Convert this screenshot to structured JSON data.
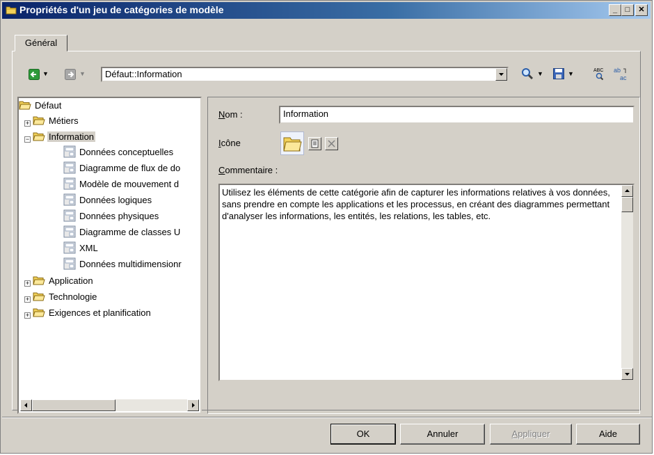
{
  "window": {
    "title": "Propriétés d'un jeu de catégories de modèle",
    "controls": {
      "minimize": "_",
      "maximize": "□",
      "close": "✕"
    }
  },
  "tabs": [
    {
      "label": "Général",
      "active": true
    }
  ],
  "toolbar": {
    "path_value": "Défaut::Information",
    "icons": [
      "back-icon",
      "forward-icon",
      "find-icon",
      "save-icon",
      "spell-check-icon",
      "replace-icon"
    ]
  },
  "tree": {
    "root": "Défaut",
    "items": [
      {
        "label": "Métiers",
        "type": "folder",
        "expander": "+"
      },
      {
        "label": "Information",
        "type": "folder",
        "expander": "−",
        "selected": true
      },
      {
        "label": "Données conceptuelles",
        "type": "model"
      },
      {
        "label": "Diagramme de flux de do",
        "type": "model"
      },
      {
        "label": "Modèle de mouvement d",
        "type": "model"
      },
      {
        "label": "Données logiques",
        "type": "model"
      },
      {
        "label": "Données physiques",
        "type": "model"
      },
      {
        "label": "Diagramme de classes U",
        "type": "model"
      },
      {
        "label": "XML",
        "type": "model"
      },
      {
        "label": "Données multidimensionr",
        "type": "model"
      },
      {
        "label": "Application",
        "type": "folder",
        "expander": "+"
      },
      {
        "label": "Technologie",
        "type": "folder",
        "expander": "+"
      },
      {
        "label": "Exigences et planification",
        "type": "folder",
        "expander": "+"
      }
    ]
  },
  "form": {
    "name_label_first": "N",
    "name_label_rest": "om :",
    "name_value": "Information",
    "icon_label_first": "I",
    "icon_label_rest": "cône",
    "comment_label_first": "C",
    "comment_label_rest": "ommentaire :",
    "comment_value": "Utilisez les éléments de cette catégorie afin de capturer les informations relatives à vos données, sans prendre en compte les applications et les processus, en créant des diagrammes permettant d'analyser les informations, les entités, les relations, les tables, etc."
  },
  "buttons": {
    "ok": "OK",
    "cancel": "Annuler",
    "apply_first": "A",
    "apply_rest": "ppliquer",
    "help": "Aide"
  },
  "colors": {
    "title_gradient_start": "#0a246a",
    "title_gradient_end": "#a6caf0",
    "dialog_face": "#d4d0c8",
    "folder_yellow": "#f2d15a",
    "back_green": "#2e9a3a"
  }
}
